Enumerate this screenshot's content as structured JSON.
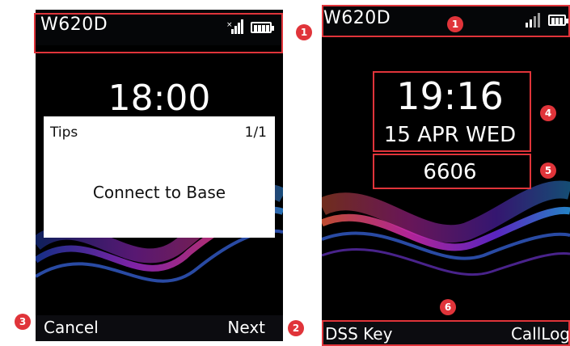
{
  "left_phone": {
    "model": "W620D",
    "time": "18:00",
    "tips": {
      "title": "Tips",
      "page": "1/1",
      "message": "Connect to Base"
    },
    "softkeys": {
      "left": "Cancel",
      "right": "Next"
    }
  },
  "right_phone": {
    "model": "W620D",
    "time": "19:16",
    "date": "15 APR WED",
    "extension": "6606",
    "softkeys": {
      "left": "DSS Key",
      "right": "CallLog"
    }
  },
  "callouts": {
    "left_status": "1",
    "next_key": "2",
    "cancel_key": "3",
    "right_status": "1",
    "time_date": "4",
    "extension": "5",
    "softkey_bar": "6"
  },
  "colors": {
    "callout": "#e0343a",
    "screen_bg": "#000000"
  },
  "icons": [
    "no-sim-signal-icon",
    "battery-icon",
    "signal-icon"
  ]
}
